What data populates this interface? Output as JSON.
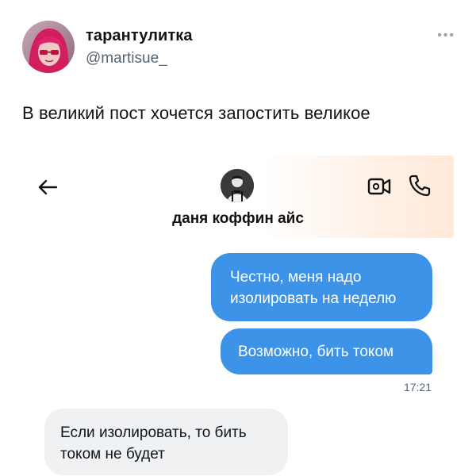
{
  "tweet": {
    "display_name": "тарантулитка",
    "handle": "@martisue_",
    "more_icon": "more-dots-icon",
    "text": "В великий пост хочется запостить великое"
  },
  "chat": {
    "contact_name": "даня коффин айс",
    "icons": {
      "back": "arrow-left-icon",
      "video": "video-call-icon",
      "phone": "phone-call-icon"
    },
    "messages": [
      {
        "direction": "outgoing",
        "lines": [
          "Честно, меня надо",
          "изолировать на неделю"
        ]
      },
      {
        "direction": "outgoing",
        "lines": [
          "Возможно, бить током"
        ]
      },
      {
        "direction": "incoming",
        "lines": [
          "Если изолировать, то бить",
          "током не будет"
        ]
      }
    ],
    "timestamp": "17:21"
  },
  "colors": {
    "outgoing_bubble": "#3d93e8",
    "incoming_bubble": "#eff1f3",
    "handle_text": "#536471"
  }
}
